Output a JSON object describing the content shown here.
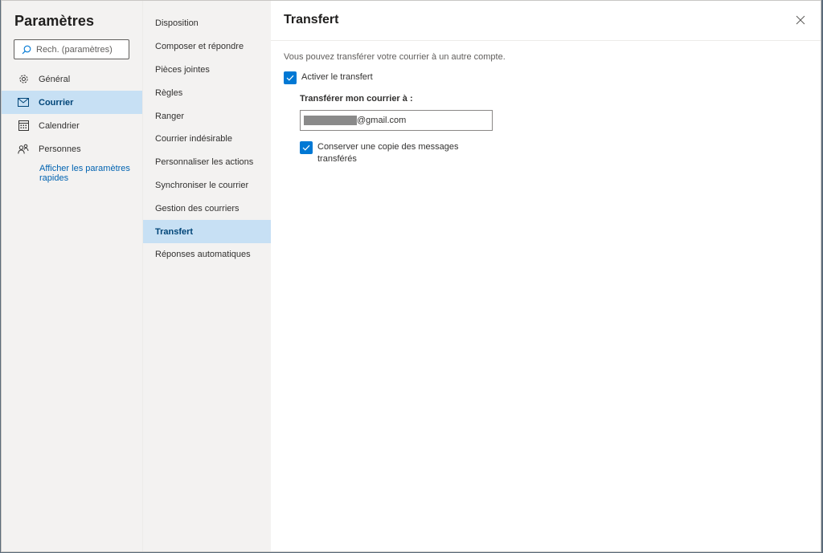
{
  "left_nav": {
    "title": "Paramètres",
    "search_placeholder": "Rech. (paramètres)",
    "items": [
      {
        "label": "Général",
        "icon": "gear-icon"
      },
      {
        "label": "Courrier",
        "icon": "mail-icon",
        "selected": true
      },
      {
        "label": "Calendrier",
        "icon": "calendar-icon"
      },
      {
        "label": "Personnes",
        "icon": "people-icon"
      }
    ],
    "quick_settings_link": "Afficher les paramètres rapides"
  },
  "mid_nav": {
    "items": [
      "Disposition",
      "Composer et répondre",
      "Pièces jointes",
      "Règles",
      "Ranger",
      "Courrier indésirable",
      "Personnaliser les actions",
      "Synchroniser le courrier",
      "Gestion des courriers",
      "Transfert",
      "Réponses automatiques"
    ],
    "selected": "Transfert"
  },
  "content": {
    "title": "Transfert",
    "description": "Vous pouvez transférer votre courrier à un autre compte.",
    "enable_forwarding": {
      "label": "Activer le transfert",
      "checked": true
    },
    "forward_to_label": "Transférer mon courrier à :",
    "forward_email_visible": "@gmail.com",
    "keep_copy": {
      "label": "Conserver une copie des messages transférés",
      "checked": true
    }
  },
  "colors": {
    "accent": "#0078d4",
    "selected_bg": "#c7e0f4",
    "link": "#0063b1",
    "nav_bg": "#f3f2f1"
  }
}
